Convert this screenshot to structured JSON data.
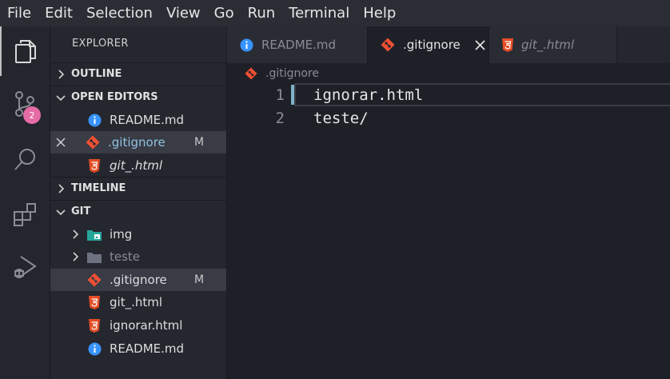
{
  "menu": [
    "File",
    "Edit",
    "Selection",
    "View",
    "Go",
    "Run",
    "Terminal",
    "Help"
  ],
  "activity": {
    "scm_badge": "2"
  },
  "explorer": {
    "title": "EXPLORER",
    "sections": {
      "outline": "OUTLINE",
      "open_editors": "OPEN EDITORS",
      "timeline": "TIMELINE",
      "git": "GIT"
    },
    "open_editors": [
      {
        "label": "README.md",
        "icon": "info-icon",
        "italic": false,
        "status": ""
      },
      {
        "label": ".gitignore",
        "icon": "git-icon",
        "italic": false,
        "status": "M"
      },
      {
        "label": "git_.html",
        "icon": "html5-icon",
        "italic": true,
        "status": ""
      }
    ],
    "git_tree": [
      {
        "label": "img",
        "icon": "image-folder-icon"
      },
      {
        "label": "teste",
        "icon": "folder-icon"
      },
      {
        "label": ".gitignore",
        "icon": "git-icon",
        "status": "M"
      },
      {
        "label": "git_.html",
        "icon": "html5-icon"
      },
      {
        "label": "ignorar.html",
        "icon": "html5-icon"
      },
      {
        "label": "README.md",
        "icon": "info-icon"
      }
    ]
  },
  "tabs": [
    {
      "label": "README.md",
      "icon": "info-icon",
      "active": false
    },
    {
      "label": ".gitignore",
      "icon": "git-icon",
      "active": true
    },
    {
      "label": "git_.html",
      "icon": "html5-icon",
      "active": false,
      "italic": true
    }
  ],
  "breadcrumb": ".gitignore",
  "editor": {
    "lines": [
      {
        "number": "1",
        "text": "ignorar.html"
      },
      {
        "number": "2",
        "text": "teste/"
      }
    ]
  },
  "colors": {
    "accent": "#7fb2c8",
    "badge": "#e56ba6",
    "html": "#e44d26",
    "git": "#f05033",
    "info": "#3794ff"
  }
}
